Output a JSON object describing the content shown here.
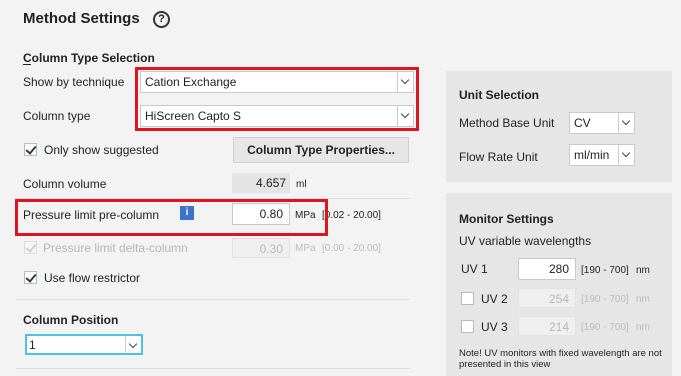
{
  "header": {
    "title": "Method Settings",
    "help_icon": "?"
  },
  "column_type_selection": {
    "title": "Column Type Selection",
    "show_by_technique": {
      "label": "Show by technique",
      "value": "Cation Exchange"
    },
    "column_type": {
      "label": "Column type",
      "value": "HiScreen Capto S"
    },
    "only_show_suggested": {
      "label": "Only show suggested",
      "checked": true
    },
    "properties_button": "Column Type Properties...",
    "column_volume": {
      "label": "Column volume",
      "value": "4.657",
      "unit": "ml"
    },
    "pressure_pre": {
      "label": "Pressure limit pre-column",
      "info_icon": "i",
      "value": "0.80",
      "unit": "MPa",
      "range": "[0.02 - 20.00]"
    },
    "pressure_delta": {
      "label": "Pressure limit delta-column",
      "value": "0.30",
      "unit": "MPa",
      "range": "[0.00 - 20.00]",
      "checked": true,
      "disabled": true
    },
    "use_flow_restrictor": {
      "label": "Use flow restrictor",
      "checked": true
    }
  },
  "column_position": {
    "title": "Column Position",
    "value": "1"
  },
  "unit_selection": {
    "title": "Unit Selection",
    "base_unit": {
      "label": "Method Base Unit",
      "value": "CV"
    },
    "flow_rate_unit": {
      "label": "Flow Rate Unit",
      "value": "ml/min"
    }
  },
  "monitor_settings": {
    "title": "Monitor Settings",
    "subtitle": "UV variable wavelengths",
    "uv1": {
      "label": "UV 1",
      "value": "280",
      "range": "[190 - 700]",
      "unit": "nm"
    },
    "uv2": {
      "label": "UV 2",
      "value": "254",
      "range": "[190 - 700]",
      "unit": "nm",
      "checked": false
    },
    "uv3": {
      "label": "UV 3",
      "value": "214",
      "range": "[190 - 700]",
      "unit": "nm",
      "checked": false
    },
    "note": "Note! UV monitors with fixed wavelength are not presented in this view"
  },
  "colors": {
    "highlight": "#e0141e",
    "info": "#3b74c9",
    "focus": "#4ec3e0"
  }
}
